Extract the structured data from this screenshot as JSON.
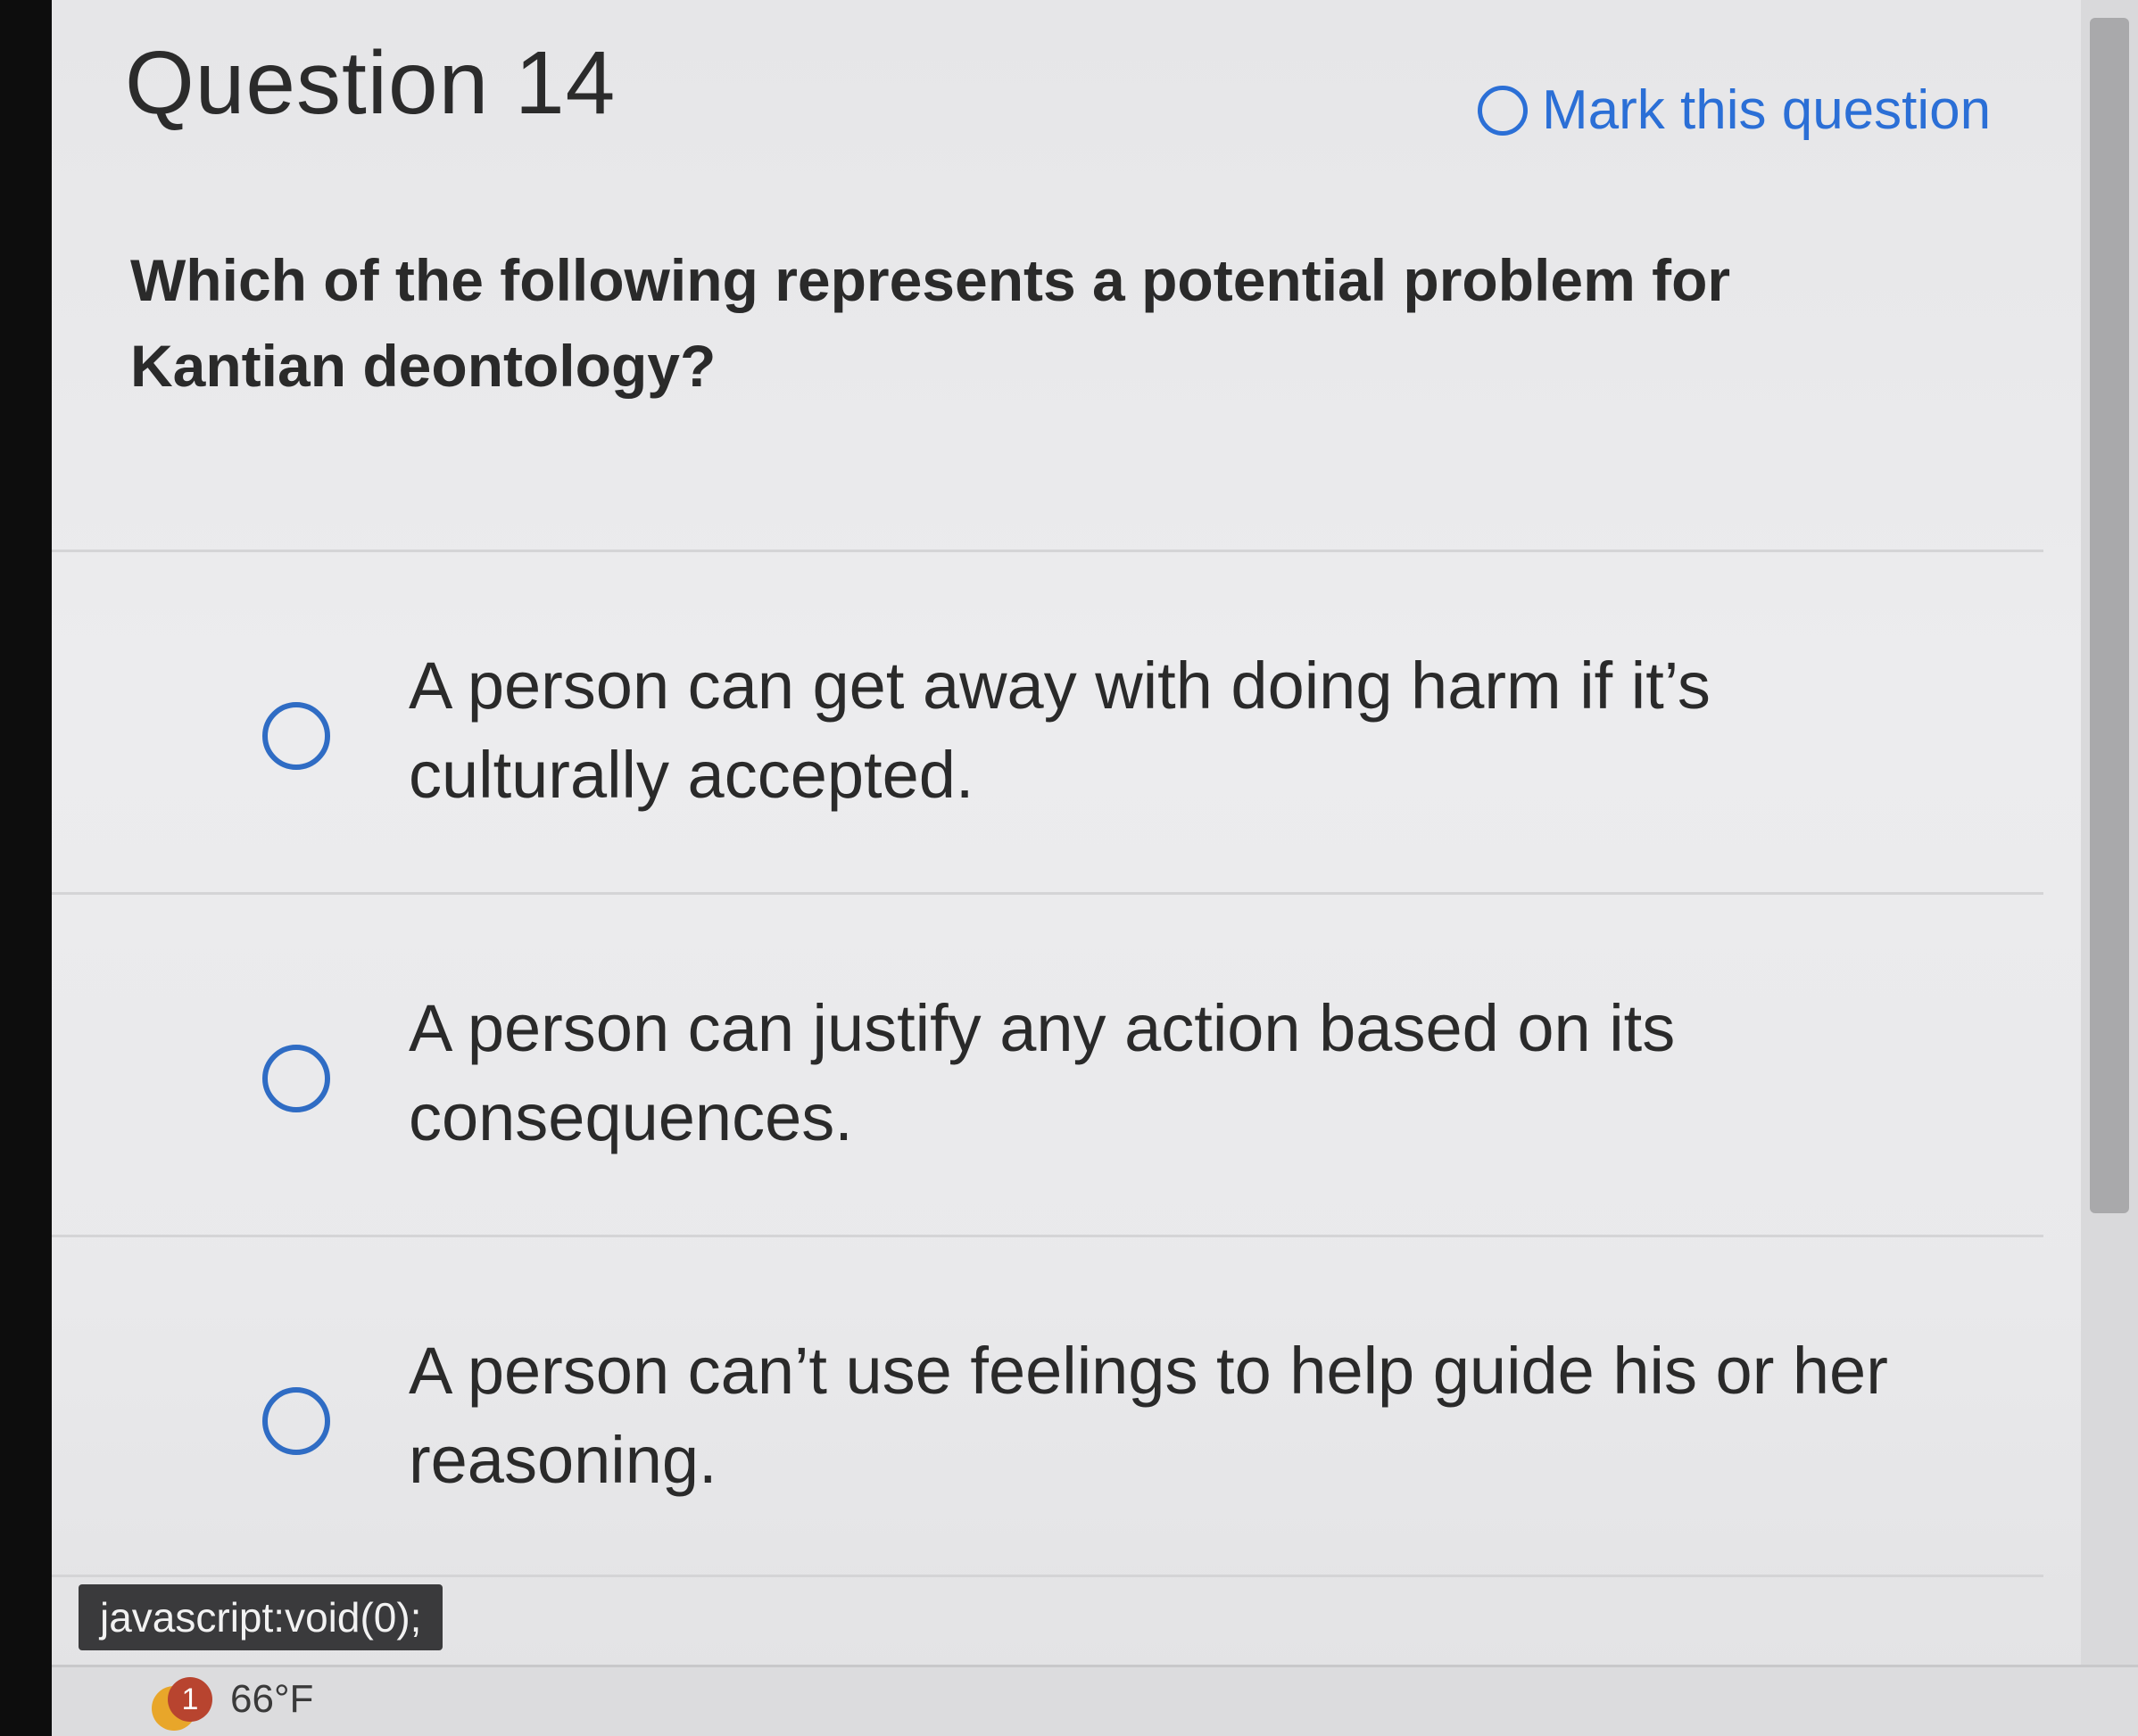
{
  "question": {
    "title": "Question 14",
    "mark_label": "Mark this question",
    "text": "Which of the following represents a potential problem for Kantian deontology?"
  },
  "options": [
    {
      "label": "A person can get away with doing harm if it’s culturally accepted."
    },
    {
      "label": "A person can justify any action based on its consequences."
    },
    {
      "label": "A person can’t use feelings to help guide his or her reasoning."
    }
  ],
  "status_bar": {
    "url": "javascript:void(0);"
  },
  "taskbar": {
    "notification_count": "1",
    "temperature": "66°F"
  },
  "colors": {
    "accent": "#2b6fd6",
    "text": "#2a2a2a",
    "background": "#e9e9eb"
  }
}
